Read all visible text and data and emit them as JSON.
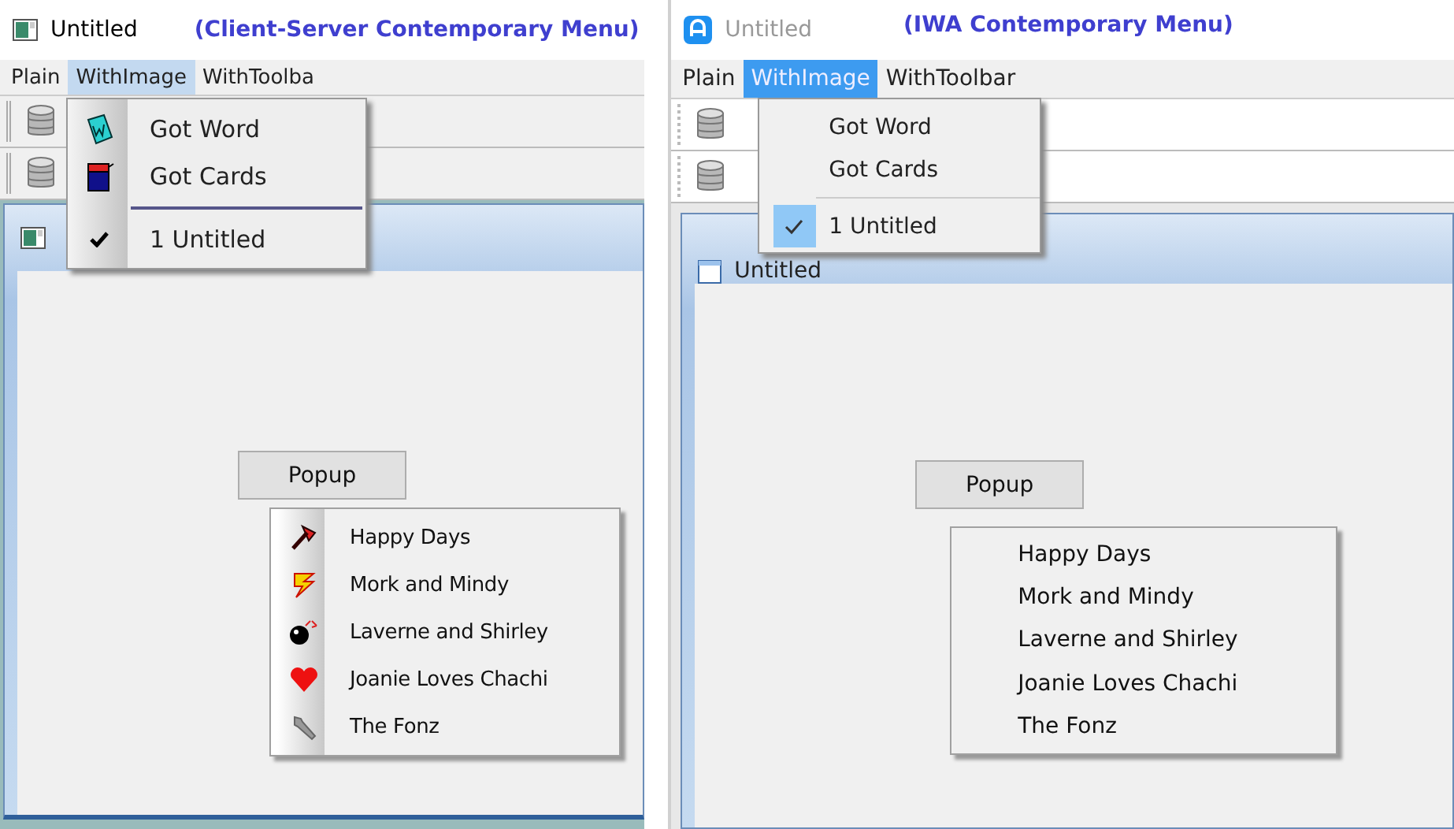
{
  "panels": [
    {
      "kind": "classic",
      "title": "Untitled",
      "caption": "(Client-Server Contemporary Menu)",
      "menus": [
        {
          "label": "Plain",
          "selected": false
        },
        {
          "label": "WithImage",
          "selected": true
        },
        {
          "label": "WithToolba",
          "selected": false
        }
      ],
      "dropdown": [
        {
          "kind": "item",
          "label": "Got Word",
          "checked": false
        },
        {
          "kind": "item",
          "label": "Got Cards",
          "checked": false
        },
        {
          "kind": "separator"
        },
        {
          "kind": "item",
          "label": "1 Untitled",
          "checked": true
        }
      ],
      "popup_button": "Popup",
      "popup_items": [
        "Happy Days",
        "Mork and Mindy",
        "Laverne and Shirley",
        "Joanie Loves Chachi",
        "The Fonz"
      ]
    },
    {
      "kind": "modern",
      "title": "Untitled",
      "caption": "(IWA Contemporary Menu)",
      "menus": [
        {
          "label": "Plain",
          "selected": false
        },
        {
          "label": "WithImage",
          "selected": true
        },
        {
          "label": "WithToolbar",
          "selected": false
        }
      ],
      "dropdown": [
        {
          "kind": "item",
          "label": "Got Word",
          "checked": false
        },
        {
          "kind": "item",
          "label": "Got Cards",
          "checked": false
        },
        {
          "kind": "separator"
        },
        {
          "kind": "item",
          "label": "1 Untitled",
          "checked": true
        }
      ],
      "child_title": "Untitled",
      "popup_button": "Popup",
      "popup_items": [
        "Happy Days",
        "Mork and Mindy",
        "Laverne and Shirley",
        "Joanie Loves Chachi",
        "The Fonz"
      ]
    }
  ]
}
